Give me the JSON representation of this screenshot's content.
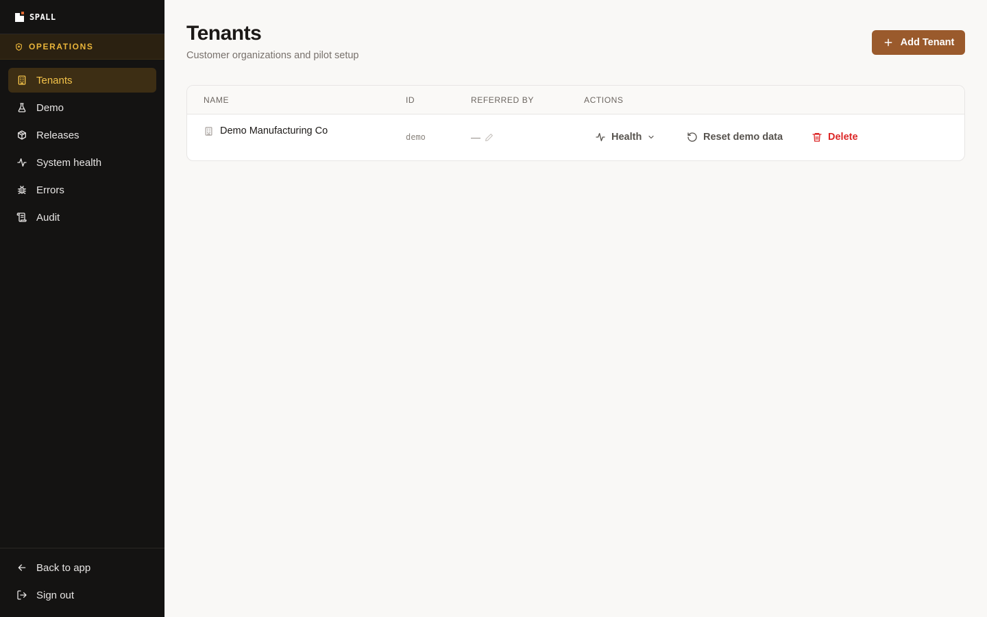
{
  "brand": {
    "name": "SPALL"
  },
  "sidebar": {
    "section_label": "OPERATIONS",
    "items": [
      {
        "label": "Tenants",
        "icon": "building-icon",
        "active": true
      },
      {
        "label": "Demo",
        "icon": "flask-icon"
      },
      {
        "label": "Releases",
        "icon": "package-icon"
      },
      {
        "label": "System health",
        "icon": "activity-icon"
      },
      {
        "label": "Errors",
        "icon": "bug-icon"
      },
      {
        "label": "Audit",
        "icon": "scroll-icon"
      }
    ],
    "footer": [
      {
        "label": "Back to app",
        "icon": "arrow-left-icon"
      },
      {
        "label": "Sign out",
        "icon": "log-out-icon"
      }
    ]
  },
  "header": {
    "title": "Tenants",
    "subtitle": "Customer organizations and pilot setup",
    "add_button": "Add Tenant"
  },
  "table": {
    "columns": [
      "NAME",
      "ID",
      "REFERRED BY",
      "ACTIONS"
    ],
    "rows": [
      {
        "name": "Demo Manufacturing Co",
        "id": "demo",
        "referred_by": "—",
        "actions": {
          "health": "Health",
          "reset": "Reset demo data",
          "delete": "Delete"
        }
      }
    ]
  },
  "colors": {
    "sidebar_bg": "#141312",
    "accent": "#f4c34a",
    "primary_button": "#9a5a2c",
    "danger": "#dc2626"
  }
}
